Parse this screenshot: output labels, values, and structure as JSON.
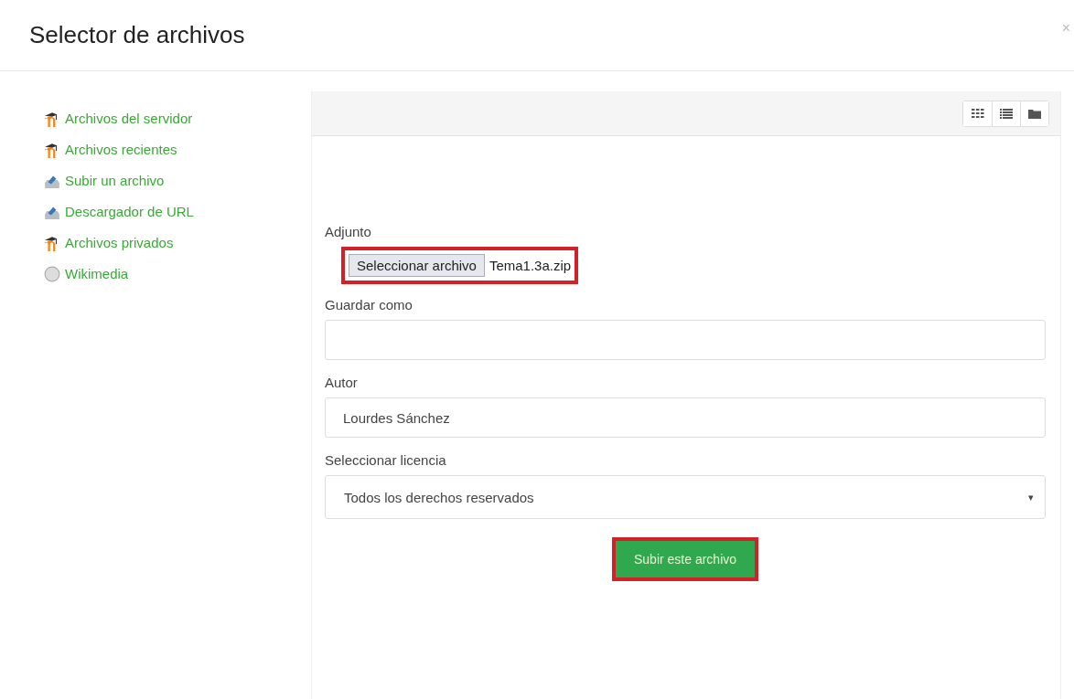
{
  "dialog": {
    "title": "Selector de archivos",
    "close": "×"
  },
  "sidebar": {
    "items": [
      {
        "label": "Archivos del servidor",
        "kind": "moodle"
      },
      {
        "label": "Archivos recientes",
        "kind": "moodle"
      },
      {
        "label": "Subir un archivo",
        "kind": "upload"
      },
      {
        "label": "Descargador de URL",
        "kind": "upload"
      },
      {
        "label": "Archivos privados",
        "kind": "moodle"
      },
      {
        "label": "Wikimedia",
        "kind": "globe"
      }
    ]
  },
  "toolbar": {
    "view_buttons": [
      {
        "kind": "grid"
      },
      {
        "kind": "list"
      },
      {
        "kind": "folder"
      }
    ]
  },
  "form": {
    "attachment": {
      "label": "Adjunto",
      "button": "Seleccionar archivo",
      "file_name": "Tema1.3a.zip",
      "highlighted": true
    },
    "save_as": {
      "label": "Guardar como"
    },
    "author": {
      "label": "Autor",
      "value": "Lourdes Sánchez"
    },
    "license": {
      "label": "Seleccionar licencia",
      "value": "Todos los derechos reservados",
      "caret": "▾"
    },
    "submit": {
      "label": "Subir este archivo",
      "highlighted": true
    }
  }
}
